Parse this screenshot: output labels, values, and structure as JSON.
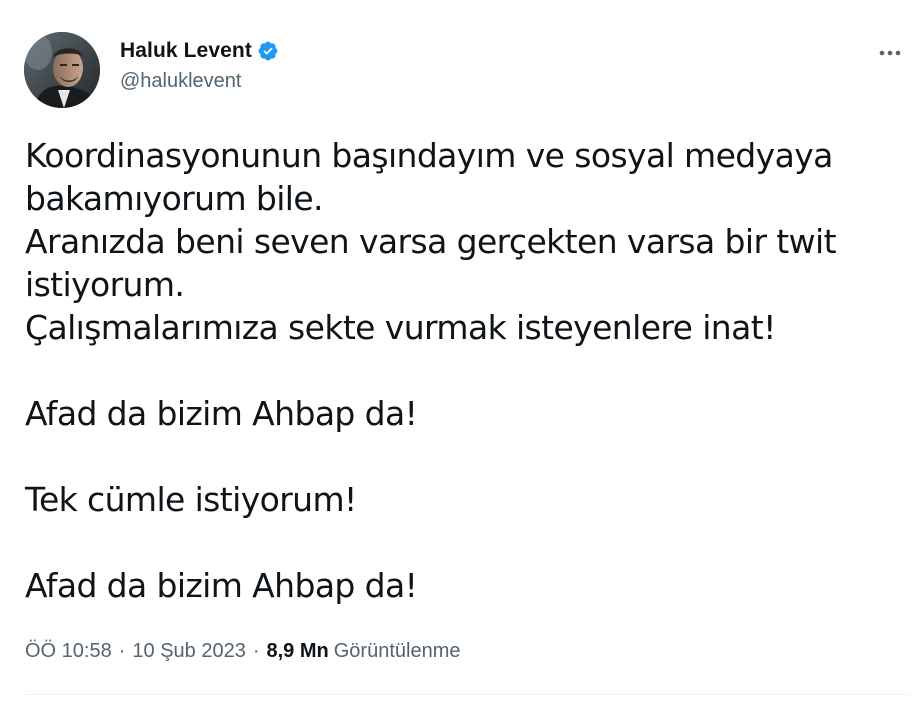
{
  "tweet": {
    "author": {
      "display_name": "Haluk Levent",
      "handle": "@haluklevent",
      "verified": true
    },
    "body_lines": [
      "Koordinasyonunun başındayım ve sosyal medyaya",
      "bakamıyorum bile.",
      "Aranızda beni seven varsa gerçekten varsa bir twit",
      "istiyorum.",
      "Çalışmalarımıza sekte vurmak isteyenlere inat!",
      "",
      "Afad da bizim Ahbap da!",
      "",
      "Tek cümle istiyorum!",
      "",
      "Afad da bizim Ahbap da!"
    ],
    "time": "ÖÖ 10:58",
    "separator": "·",
    "date": "10 Şub 2023",
    "views_count": "8,9 Mn",
    "views_label": "Görüntülenme"
  },
  "colors": {
    "text_primary": "#0f1419",
    "text_secondary": "#536471",
    "verified_blue": "#1d9bf0",
    "divider": "#eff3f4"
  },
  "icons": {
    "verified": "verified-badge-icon",
    "more": "more-options-icon",
    "avatar": "profile-photo"
  }
}
